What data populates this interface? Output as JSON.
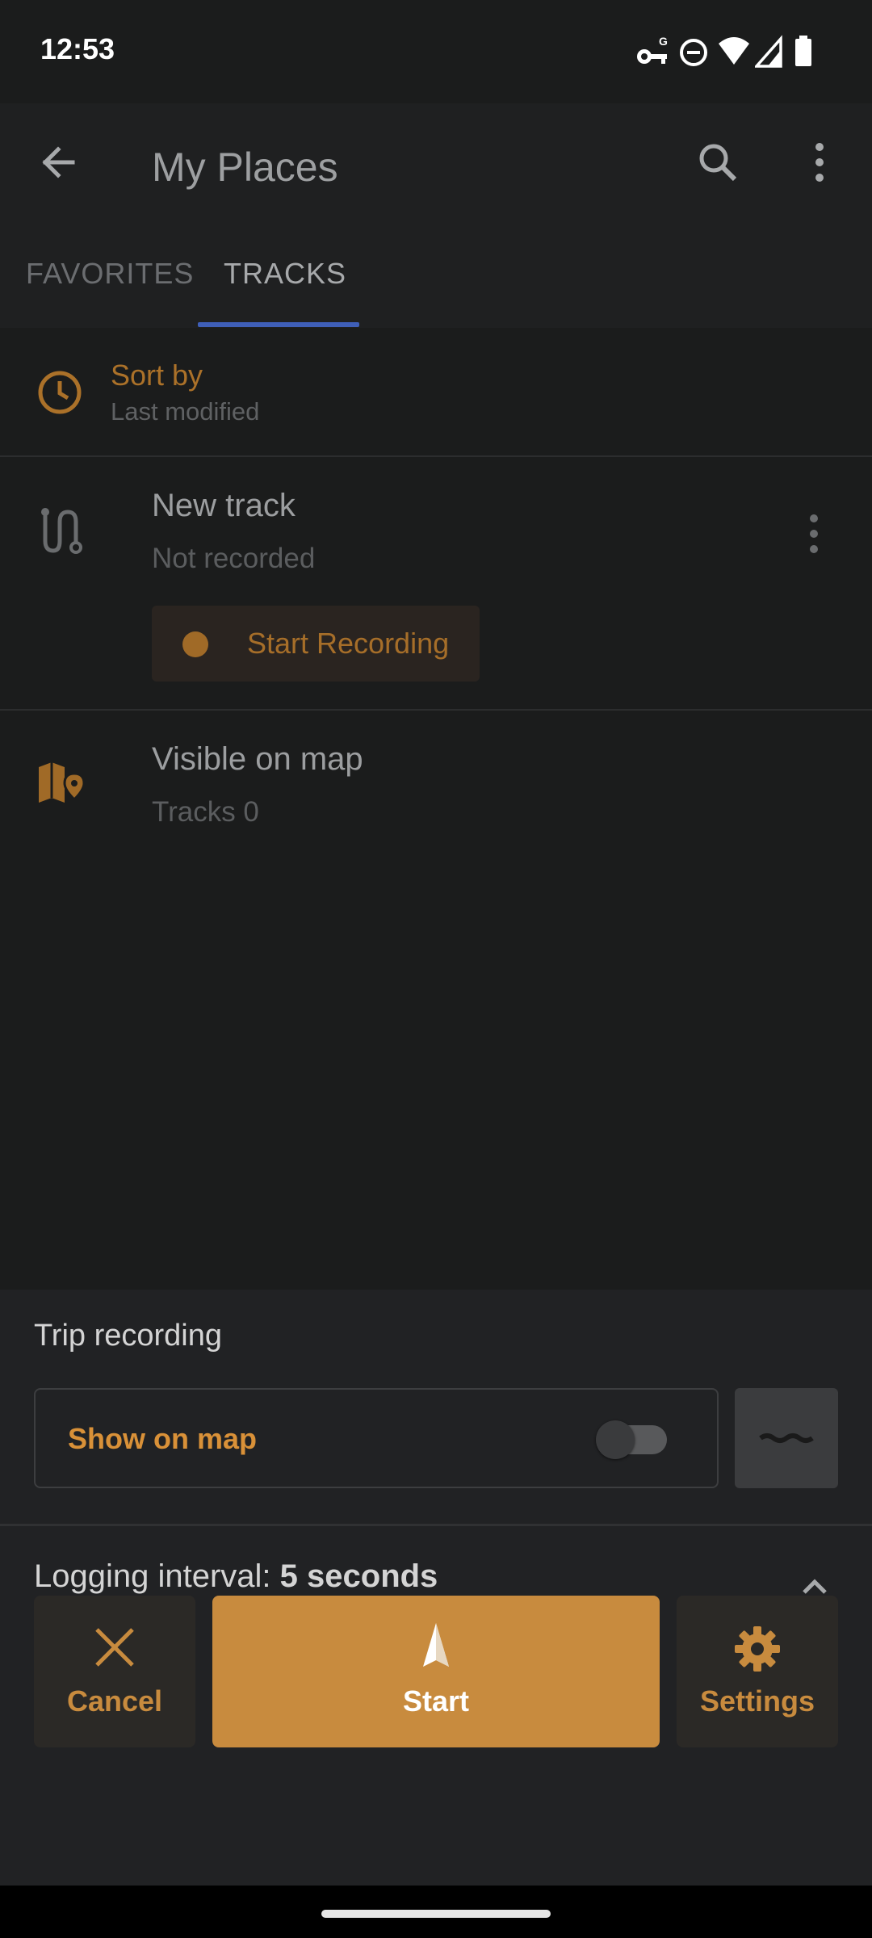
{
  "status_bar": {
    "time": "12:53",
    "icons": [
      "vpn-key-icon",
      "do-not-disturb-icon",
      "wifi-icon",
      "cell-signal-icon",
      "battery-icon"
    ]
  },
  "app_bar": {
    "title": "My Places",
    "back_icon": "arrow-back-icon",
    "search_icon": "search-icon",
    "more_icon": "more-vertical-icon",
    "tabs": [
      {
        "label": "FAVORITES",
        "selected": false
      },
      {
        "label": "TRACKS",
        "selected": true
      }
    ]
  },
  "sort": {
    "title": "Sort by",
    "value": "Last modified",
    "icon": "clock-icon"
  },
  "new_track": {
    "title": "New track",
    "status": "Not recorded",
    "icon": "route-icon",
    "record_button": "Start Recording"
  },
  "visible": {
    "title": "Visible on map",
    "subtitle": "Tracks 0",
    "icon": "map-pin-icon"
  },
  "sheet": {
    "title": "Trip recording",
    "show_on_map_label": "Show on map",
    "show_on_map_enabled": false,
    "line_icon": "track-line-icon",
    "interval_label": "Logging interval: ",
    "interval_value": "5 seconds",
    "collapse_icon": "chevron-up-icon"
  },
  "actions": {
    "cancel": "Cancel",
    "start": "Start",
    "settings": "Settings"
  },
  "colors": {
    "accent": "#c88b3e",
    "accent_dim": "#ab7129",
    "tab_indicator": "#3f5fb8",
    "background": "#1b1c1c",
    "sheet": "#212224"
  }
}
